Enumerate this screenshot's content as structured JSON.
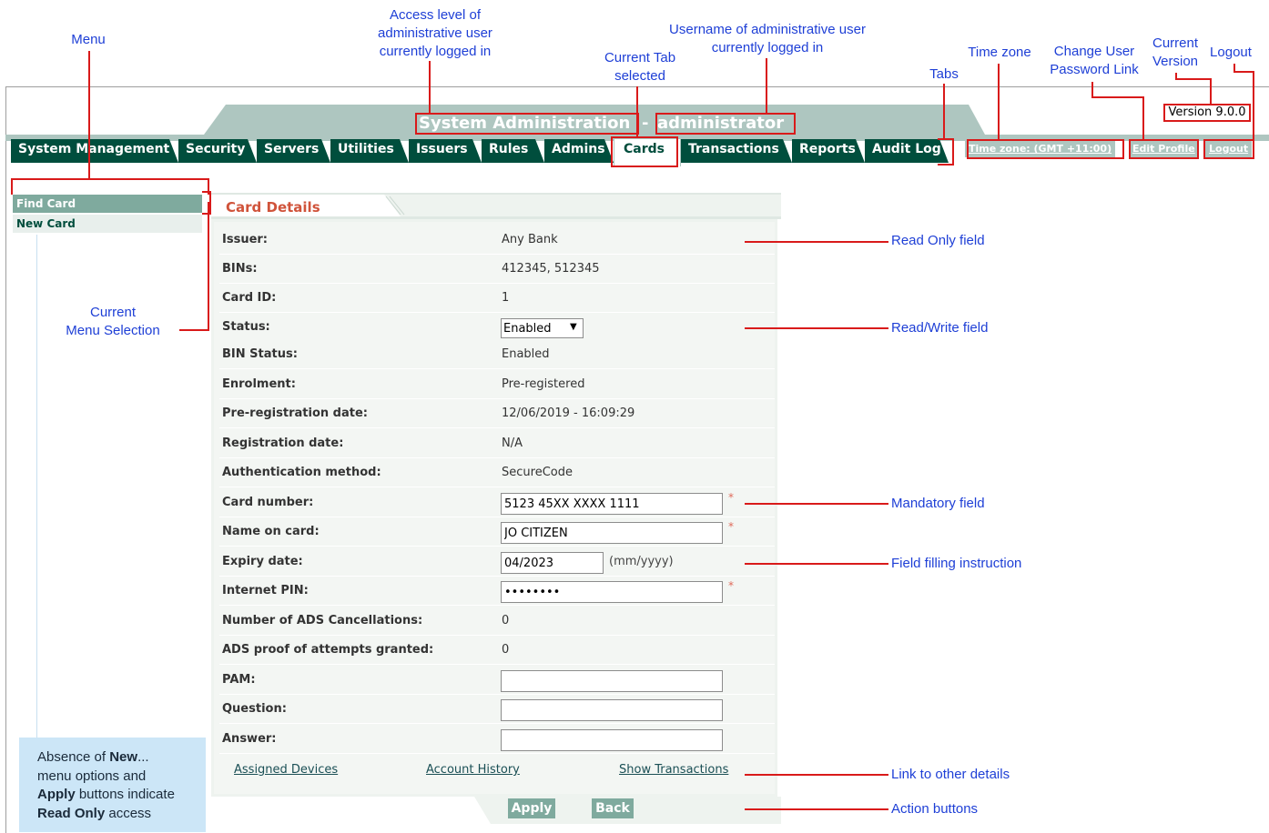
{
  "annotations": {
    "menu": "Menu",
    "access_level": [
      "Access level of",
      "administrative user",
      "currently logged in"
    ],
    "current_tab": [
      "Current Tab",
      "selected"
    ],
    "username": [
      "Username of administrative user",
      "currently logged in"
    ],
    "tabs": "Tabs",
    "time_zone": "Time zone",
    "change_password": [
      "Change User",
      "Password Link"
    ],
    "current_version": [
      "Current",
      "Version"
    ],
    "logout": "Logout",
    "current_menu_selection": [
      "Current",
      "Menu Selection"
    ],
    "read_only_field": "Read Only field",
    "read_write_field": "Read/Write field",
    "mandatory_field": "Mandatory field",
    "field_instruction": "Field filling instruction",
    "link_other_details": "Link to other details",
    "action_buttons": "Action buttons",
    "note_parts": [
      "Absence of ",
      "New",
      "...",
      "menu options and",
      "Apply",
      " buttons indicate",
      "Read Only",
      " access"
    ]
  },
  "header": {
    "title": "System Administration",
    "separator": "-",
    "user": "administrator",
    "version": "Version 9.0.0",
    "time_zone_link": "Time zone: (GMT +11:00)",
    "edit_profile_link": "Edit Profile",
    "logout_link": "Logout"
  },
  "tabs": [
    "System Management",
    "Security",
    "Servers",
    "Utilities",
    "Issuers",
    "Rules",
    "Admins",
    "Cards",
    "Transactions",
    "Reports",
    "Audit Log"
  ],
  "active_tab": "Cards",
  "menu": {
    "items": [
      "Find Card",
      "New Card"
    ]
  },
  "panel": {
    "title": "Card Details",
    "fields": {
      "issuer": {
        "label": "Issuer:",
        "value": "Any Bank"
      },
      "bins": {
        "label": "BINs:",
        "value": "412345, 512345"
      },
      "card_id": {
        "label": "Card ID:",
        "value": "1"
      },
      "status": {
        "label": "Status:",
        "value": "Enabled"
      },
      "bin_status": {
        "label": "BIN Status:",
        "value": "Enabled"
      },
      "enrolment": {
        "label": "Enrolment:",
        "value": "Pre-registered"
      },
      "prereg_date": {
        "label": "Pre-registration date:",
        "value": "12/06/2019 - 16:09:29"
      },
      "reg_date": {
        "label": "Registration date:",
        "value": "N/A"
      },
      "auth_method": {
        "label": "Authentication method:",
        "value": "SecureCode"
      },
      "card_number": {
        "label": "Card number:",
        "value": "5123 45XX XXXX 1111"
      },
      "name_on_card": {
        "label": "Name on card:",
        "value": "JO CITIZEN"
      },
      "expiry": {
        "label": "Expiry date:",
        "value": "04/2023",
        "hint": "(mm/yyyy)"
      },
      "pin": {
        "label": "Internet PIN:",
        "value": "••••••••"
      },
      "ads_cancel": {
        "label": "Number of ADS Cancellations:",
        "value": "0"
      },
      "ads_proof": {
        "label": "ADS proof of attempts granted:",
        "value": "0"
      },
      "pam": {
        "label": "PAM:",
        "value": ""
      },
      "question": {
        "label": "Question:",
        "value": ""
      },
      "answer": {
        "label": "Answer:",
        "value": ""
      }
    },
    "required_mark": "*",
    "links": {
      "assigned_devices": "Assigned Devices",
      "account_history": "Account History",
      "show_transactions": "Show Transactions"
    }
  },
  "buttons": {
    "apply": "Apply",
    "back": "Back"
  },
  "colors": {
    "tab_bg": "#004e3d",
    "banner": "#aec6c0",
    "annotation_text": "#1e3fd6",
    "annotation_line": "#d91a1a",
    "panel_title": "#d0533a"
  }
}
